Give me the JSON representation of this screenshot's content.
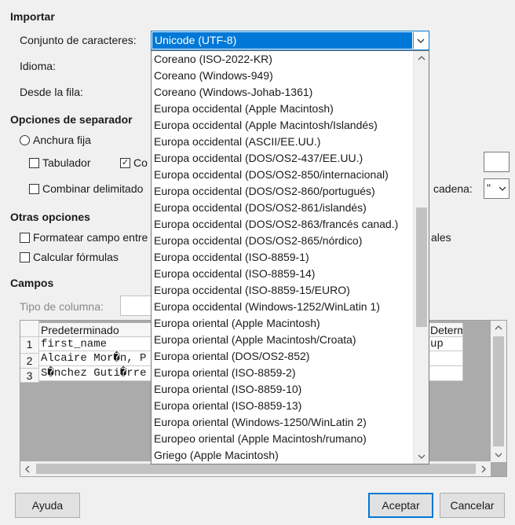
{
  "importar": {
    "heading": "Importar",
    "charset_label": "Conjunto de caracteres:",
    "charset_value": "Unicode (UTF-8)",
    "idioma_label": "Idioma:",
    "desde_fila_label": "Desde la fila:"
  },
  "charset_options": [
    "Coreano (ISO-2022-KR)",
    "Coreano (Windows-949)",
    "Coreano (Windows-Johab-1361)",
    "Europa occidental (Apple Macintosh)",
    "Europa occidental (Apple Macintosh/Islandés)",
    "Europa occidental (ASCII/EE.UU.)",
    "Europa occidental (DOS/OS2-437/EE.UU.)",
    "Europa occidental (DOS/OS2-850/internacional)",
    "Europa occidental (DOS/OS2-860/portugués)",
    "Europa occidental (DOS/OS2-861/islandés)",
    "Europa occidental (DOS/OS2-863/francés canad.)",
    "Europa occidental (DOS/OS2-865/nórdico)",
    "Europa occidental (ISO-8859-1)",
    "Europa occidental (ISO-8859-14)",
    "Europa occidental (ISO-8859-15/EURO)",
    "Europa occidental (Windows-1252/WinLatin 1)",
    "Europa oriental (Apple Macintosh)",
    "Europa oriental (Apple Macintosh/Croata)",
    "Europa oriental (DOS/OS2-852)",
    "Europa oriental (ISO-8859-2)",
    "Europa oriental (ISO-8859-10)",
    "Europa oriental (ISO-8859-13)",
    "Europa oriental (Windows-1250/WinLatin 2)",
    "Europeo oriental (Apple Macintosh/rumano)",
    "Griego (Apple Macintosh)"
  ],
  "dropdown_scroll": {
    "thumb_start_fraction": 0.37,
    "thumb_end_fraction": 0.68
  },
  "separador": {
    "heading": "Opciones de separador",
    "anchura_fija": "Anchura fija",
    "tabulador": "Tabulador",
    "coma_partial": "Co",
    "combinar": "Combinar delimitado",
    "cadena_label": "cadena:",
    "cadena_value": "\""
  },
  "otras": {
    "heading": "Otras opciones",
    "formatear": "Formatear campo entre",
    "formatear_tail": "ales",
    "calcular": "Calcular fórmulas"
  },
  "campos": {
    "heading": "Campos",
    "tipo_columna_label": "Tipo de columna:",
    "header_left": "Predeterminado",
    "header_right": "Determ",
    "rows": [
      {
        "num": "1",
        "left": "first_name",
        "right": "up"
      },
      {
        "num": "2",
        "left": "Alcaire Mor�n, P",
        "right": ""
      },
      {
        "num": "3",
        "left": "S�nchez Guti�rre",
        "right": ""
      }
    ]
  },
  "buttons": {
    "ayuda": "Ayuda",
    "aceptar": "Aceptar",
    "cancelar": "Cancelar"
  }
}
